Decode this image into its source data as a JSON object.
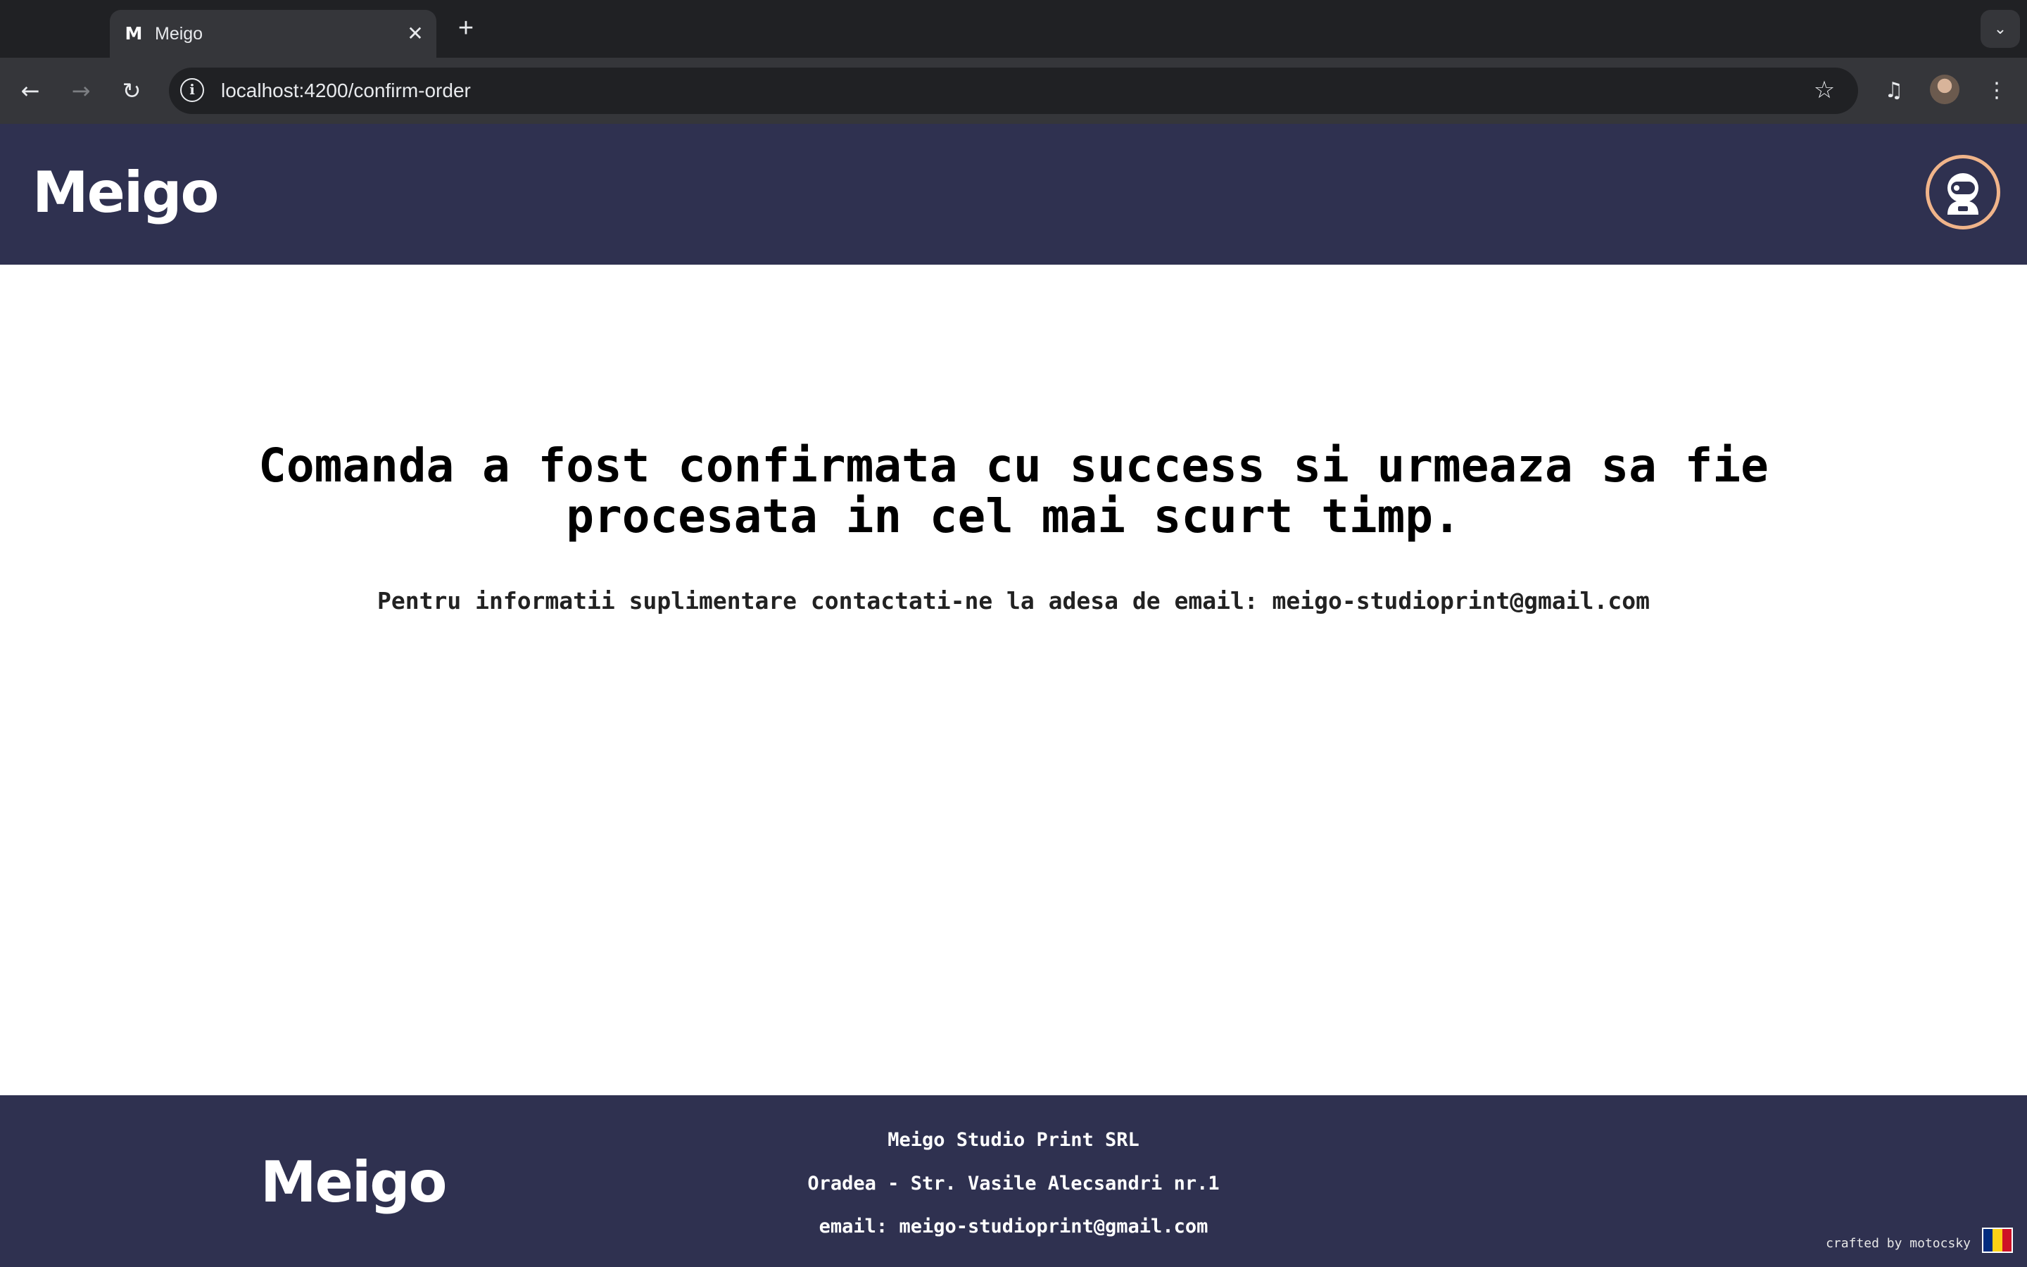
{
  "browser": {
    "tab": {
      "title": "Meigo",
      "favicon": "M"
    },
    "url": "localhost:4200/confirm-order",
    "icons": {
      "back": "arrow-left-icon",
      "forward": "arrow-right-icon",
      "reload": "reload-icon",
      "info": "info-icon",
      "bookmark": "star-icon",
      "media": "media-controls-icon",
      "profile": "profile-avatar",
      "menu": "kebab-menu-icon",
      "tab_search": "chevron-down-icon"
    }
  },
  "header": {
    "logo": "Meigo",
    "account_icon": "astronaut-avatar-icon",
    "account_ring_color": "#f0b48a",
    "background": "#2f3150"
  },
  "main": {
    "title": "Comanda a fost confirmata cu success si urmeaza sa fie procesata in cel mai scurt timp.",
    "info": "Pentru informatii suplimentare contactati-ne la adesa de email: meigo-studioprint@gmail.com"
  },
  "footer": {
    "logo": "Meigo",
    "company": "Meigo Studio Print SRL",
    "address": "Oradea - Str. Vasile Alecsandri nr.1",
    "email": "email: meigo-studioprint@gmail.com",
    "credit": "crafted by motocsky",
    "flag_colors": [
      "#002b7f",
      "#fcd116",
      "#ce1126"
    ]
  }
}
